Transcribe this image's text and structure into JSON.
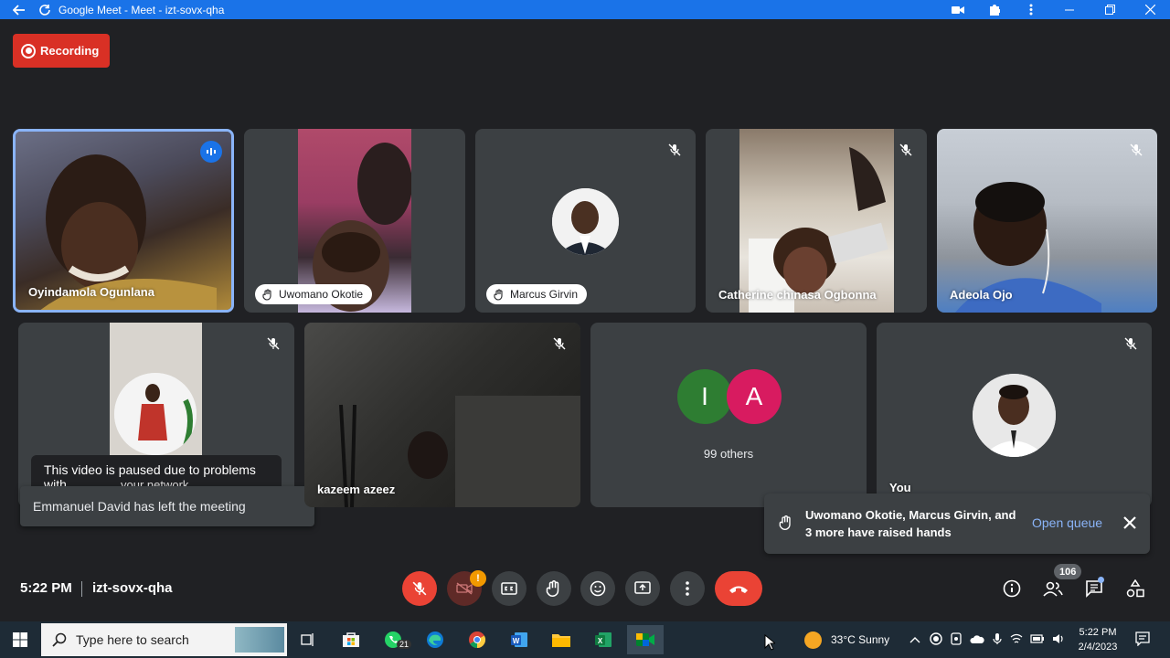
{
  "titlebar": {
    "title": "Google Meet - Meet - izt-sovx-qha"
  },
  "recording": {
    "label": "Recording"
  },
  "participants": [
    {
      "name": "Oyindamola Ogunlana"
    },
    {
      "name": "Uwomano Okotie"
    },
    {
      "name": "Marcus Girvin"
    },
    {
      "name": "Catherine chinasa Ogbonna"
    },
    {
      "name": "Adeola Ojo"
    },
    {
      "name": ""
    },
    {
      "name": "kazeem azeez"
    },
    {
      "name": "99 others",
      "letters": [
        "I",
        "A"
      ]
    },
    {
      "name": "You"
    }
  ],
  "notifications": {
    "paused_line1": "This video is paused due to problems with",
    "paused_line2": "your network",
    "left_meeting": "Emmanuel David has left the meeting",
    "raised_hands": "Uwomano Okotie, Marcus Girvin, and 3 more have raised hands",
    "open_queue": "Open queue"
  },
  "bottombar": {
    "time": "5:22 PM",
    "meeting_code": "izt-sovx-qha",
    "camera_alert": "!",
    "people_count": "106"
  },
  "taskbar": {
    "search_placeholder": "Type here to search",
    "whatsapp_count": "21",
    "weather": "33°C  Sunny",
    "time": "5:22 PM",
    "date": "2/4/2023"
  },
  "colors": {
    "accent": "#1a73e8",
    "recording": "#d93025",
    "leave": "#ea4335",
    "letter_i": "#2e7d32",
    "letter_a": "#d81b60"
  }
}
